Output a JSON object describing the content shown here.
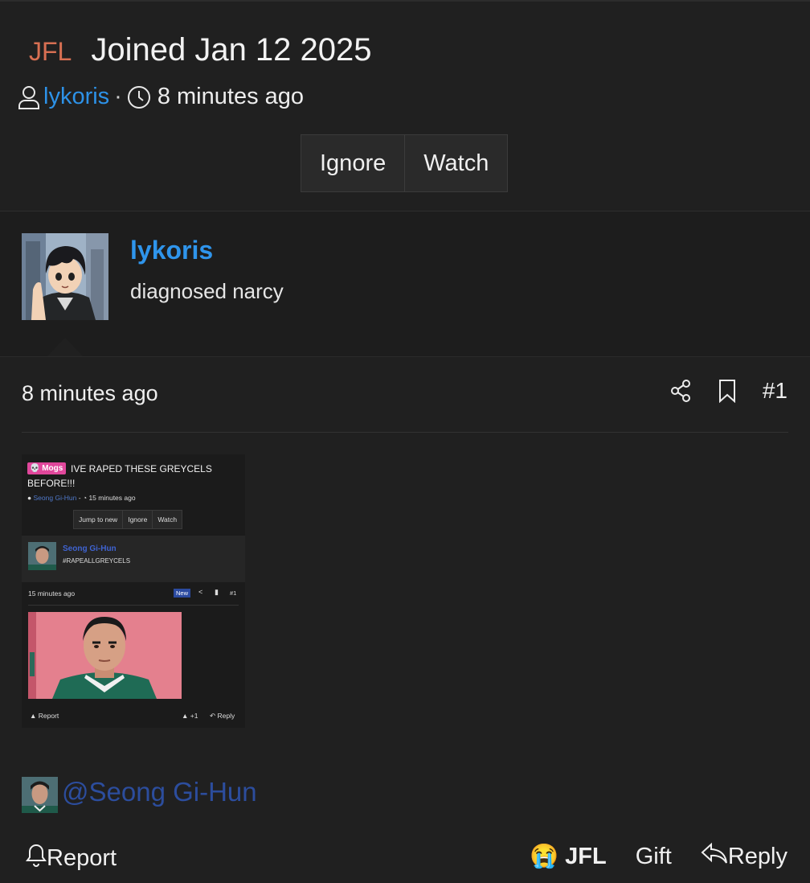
{
  "thread": {
    "prefix": "JFL",
    "title": "Joined Jan 12 2025",
    "author": "lykoris",
    "separator": "·",
    "time": "8 minutes ago",
    "buttons": {
      "ignore": "Ignore",
      "watch": "Watch"
    }
  },
  "user": {
    "name": "lykoris",
    "title": "diagnosed narcy"
  },
  "post": {
    "time": "8 minutes ago",
    "number": "#1",
    "icons": {
      "share": "share-icon",
      "bookmark": "bookmark-icon"
    }
  },
  "embedded_screenshot": {
    "badge": "💀 Mogs",
    "title": "IVE RAPED THESE GREYCELS BEFORE!!!",
    "author": "Seong Gi-Hun",
    "meta_sep": " - ",
    "time": "15 minutes ago",
    "buttons": [
      "Jump to new",
      "Ignore",
      "Watch"
    ],
    "user_name": "Seong Gi-Hun",
    "user_title": "#RAPEALLGREYCELS",
    "post_time": "15 minutes ago",
    "new_badge": "New",
    "post_number": "#1",
    "report": "Report",
    "like": "+1",
    "reply": "Reply"
  },
  "mention": "@Seong Gi-Hun",
  "footer": {
    "report": "Report",
    "reaction_emoji": "😭",
    "reaction": "JFL",
    "gift": "Gift",
    "reply": "Reply"
  },
  "colors": {
    "background": "#202020",
    "link": "#2d92e8",
    "prefix": "#d76f52",
    "mention": "#2c4d9d"
  }
}
